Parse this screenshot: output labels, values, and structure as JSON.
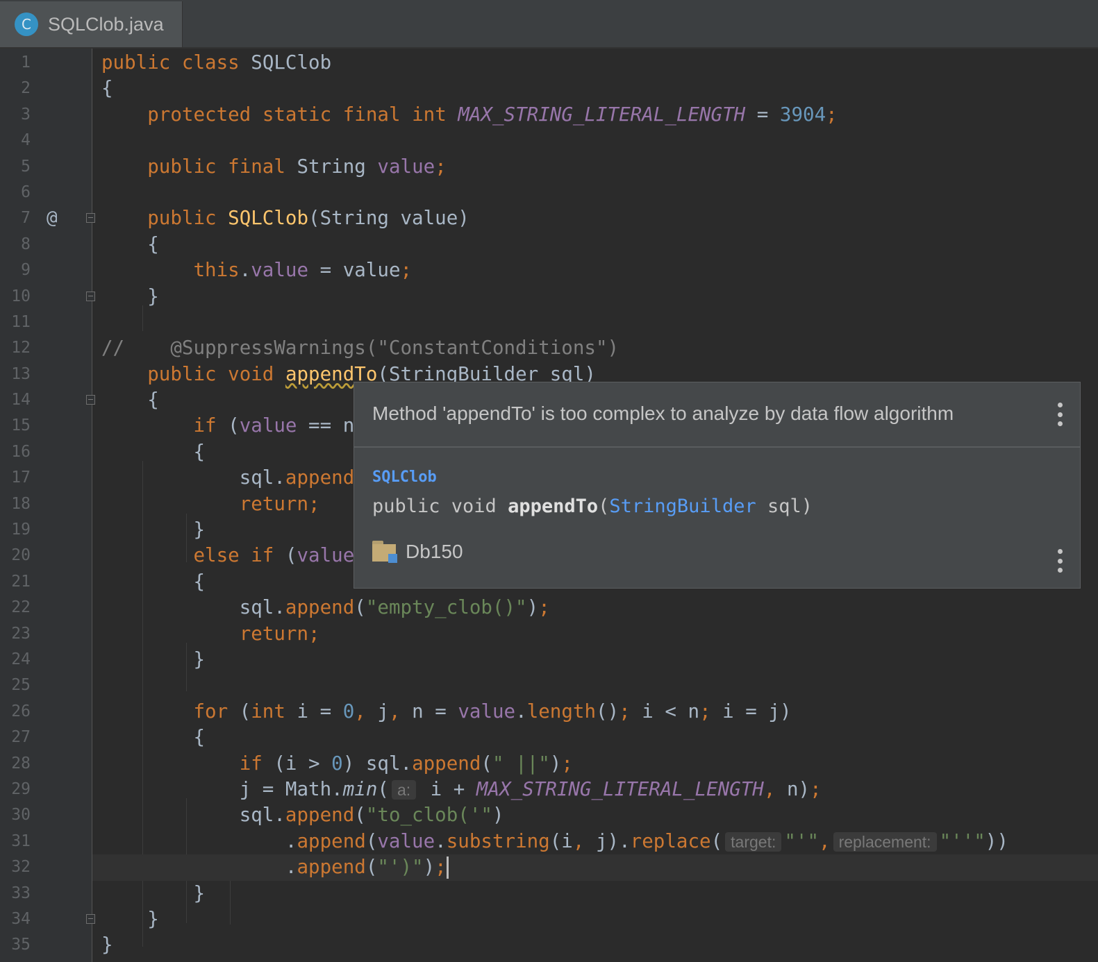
{
  "tab": {
    "file_icon": "C",
    "file_name": "SQLClob.java"
  },
  "gutter_marks": {
    "override_icon": "@"
  },
  "code": {
    "l1": [
      "public",
      "class",
      "SQLClob"
    ],
    "l2": [
      "{"
    ],
    "l3": [
      "protected",
      "static",
      "final",
      "int",
      "MAX_STRING_LITERAL_LENGTH",
      "=",
      "3904",
      ";"
    ],
    "l5": [
      "public",
      "final",
      "String",
      "value",
      ";"
    ],
    "l7": [
      "public",
      "SQLClob",
      "(String value)"
    ],
    "l8": [
      "{"
    ],
    "l9": [
      "this",
      ".",
      "value",
      " = value",
      ";"
    ],
    "l10": [
      "}"
    ],
    "l12": [
      "//",
      "@SuppressWarnings(\"ConstantConditions\")"
    ],
    "l13": [
      "public",
      "void",
      "appendTo",
      "(StringBuilder sql)"
    ],
    "l14": [
      "{"
    ],
    "l15": [
      "if",
      " (",
      "value",
      " == nu"
    ],
    "l16": [
      "{"
    ],
    "l17": [
      "sql.",
      "append",
      "("
    ],
    "l18": [
      "return",
      ";"
    ],
    "l19": [
      "}"
    ],
    "l20": [
      "else",
      "if",
      " (",
      "value",
      "."
    ],
    "l21": [
      "{"
    ],
    "l22": [
      "sql.",
      "append",
      "(",
      "\"empty_clob()\"",
      ")",
      ";"
    ],
    "l23": [
      "return",
      ";"
    ],
    "l24": [
      "}"
    ],
    "l26": [
      "for",
      " (",
      "int",
      " i = ",
      "0",
      ",",
      " j",
      ",",
      " n = ",
      "value",
      ".",
      "length",
      "()",
      ";",
      " i < n",
      ";",
      " i = j)"
    ],
    "l27": [
      "{"
    ],
    "l28": [
      "if",
      " (i > ",
      "0",
      ") sql.",
      "append",
      "(",
      "\" ||\"",
      ")",
      ";"
    ],
    "l29": [
      "j = Math.",
      "min",
      "(",
      "a:",
      " i + ",
      "MAX_STRING_LITERAL_LENGTH",
      ",",
      " n)",
      ";"
    ],
    "l30": [
      "sql.",
      "append",
      "(",
      "\"to_clob('\"",
      ")"
    ],
    "l31": [
      ".",
      "append",
      "(",
      "value",
      ".",
      "substring",
      "(i",
      ",",
      " j).",
      "replace",
      "(",
      "target:",
      "\"'\"",
      ",",
      "replacement:",
      "\"''\"",
      "))"
    ],
    "l32": [
      ".",
      "append",
      "(",
      "\"')\"",
      ")",
      ";"
    ],
    "l33": [
      "}"
    ],
    "l34": [
      "}"
    ],
    "l35": [
      "}"
    ]
  },
  "popup": {
    "message": "Method 'appendTo' is too complex to analyze by data flow algorithm",
    "class_name": "SQLClob",
    "signature_prefix": "public void ",
    "method_name": "appendTo",
    "param_type": "StringBuilder",
    "param_rest": " sql)",
    "module_icon": "folder-module-icon",
    "module_name": "Db150"
  },
  "colors": {
    "background": "#2b2b2b",
    "keyword": "#cc7832",
    "field": "#9876aa",
    "number": "#6897bb",
    "string": "#6a8759",
    "method_decl": "#ffc66d",
    "popup_bg": "#45484a",
    "popup_link": "#589df6"
  }
}
